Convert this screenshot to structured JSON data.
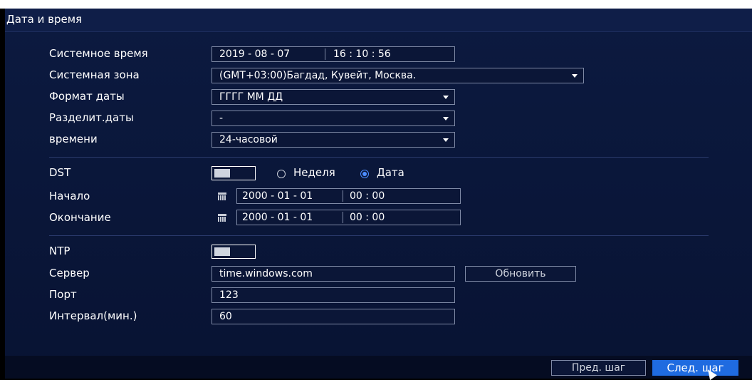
{
  "window": {
    "title": "Дата и время"
  },
  "system_time": {
    "label": "Системное время",
    "date": "2019  - 08 - 07",
    "time": "16 : 10 : 56"
  },
  "system_zone": {
    "label": "Системная зона",
    "value": "(GMT+03:00)Багдад, Кувейт, Москва."
  },
  "date_format": {
    "label": "Формат даты",
    "value": "ГГГГ ММ ДД"
  },
  "date_separator": {
    "label": "Разделит.даты",
    "value": "-"
  },
  "time_format": {
    "label": "времени",
    "value": "24-часовой"
  },
  "dst": {
    "label": "DST",
    "enabled": false,
    "option_week": "Неделя",
    "option_date": "Дата",
    "selected": "Дата",
    "start": {
      "label": "Начало",
      "date": "2000 - 01 - 01",
      "time": "00 : 00"
    },
    "end": {
      "label": "Окончание",
      "date": "2000 - 01 - 01",
      "time": "00 : 00"
    }
  },
  "ntp": {
    "label": "NTP",
    "enabled": false,
    "server": {
      "label": "Сервер",
      "value": "time.windows.com"
    },
    "update_label": "Обновить",
    "port": {
      "label": "Порт",
      "value": "123"
    },
    "interval": {
      "label": "Интервал(мин.)",
      "value": "60"
    }
  },
  "footer": {
    "prev_label": "Пред. шаг",
    "next_label": "След. шаг"
  },
  "icons": {
    "calendar": "calendar-icon",
    "dropdown": "chevron-down-icon"
  },
  "colors": {
    "accent": "#1f6be0",
    "radio_selected": "#4d8eff",
    "background": "#0c1a40"
  }
}
